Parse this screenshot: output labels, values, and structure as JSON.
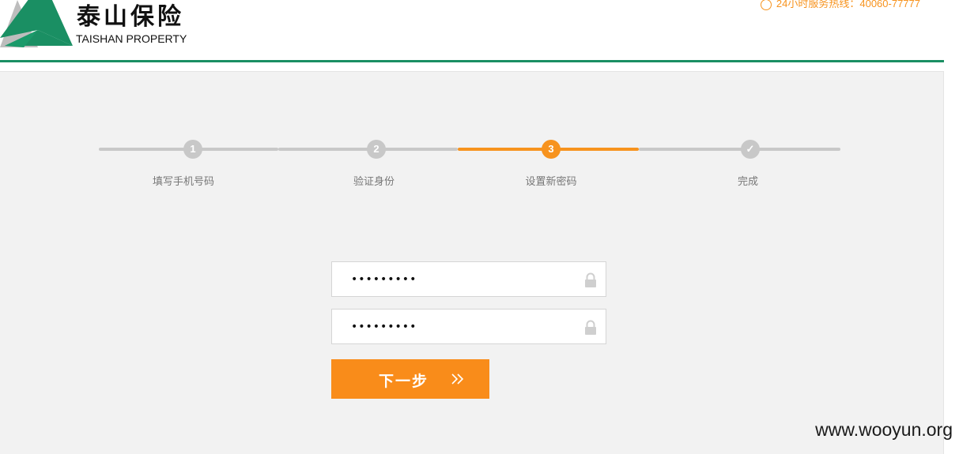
{
  "header": {
    "logo_cn": "泰山保险",
    "logo_en": "TAISHAN PROPERTY",
    "hotline_label": "24小时服务热线：",
    "hotline_number": "40060-77777"
  },
  "colors": {
    "brand_green": "#1a8f63",
    "accent_orange": "#f7931e",
    "inactive_gray": "#c8c8c8"
  },
  "steps": [
    {
      "number": "1",
      "label": "填写手机号码",
      "state": "done"
    },
    {
      "number": "2",
      "label": "验证身份",
      "state": "done"
    },
    {
      "number": "3",
      "label": "设置新密码",
      "state": "active"
    },
    {
      "number": "✓",
      "label": "完成",
      "state": "pending"
    }
  ],
  "form": {
    "new_password_value": "•••••••••",
    "confirm_password_value": "•••••••••",
    "next_button_label": "下一步"
  },
  "watermark": "www.wooyun.org"
}
